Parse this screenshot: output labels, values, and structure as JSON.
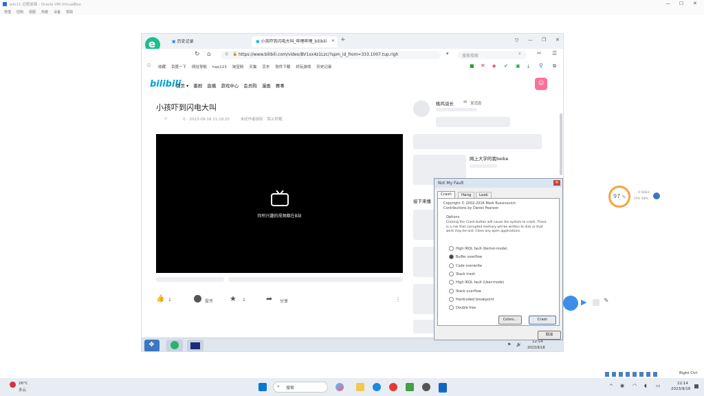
{
  "outer": {
    "title": "win11 远程桌面 - Oracle VM VirtualBox",
    "menu": [
      "管理",
      "控制",
      "视图",
      "热键",
      "设备",
      "帮助"
    ]
  },
  "browser": {
    "tabs": [
      {
        "label": "历史记录"
      },
      {
        "label": "小孩吓到闪电大叫_哔哩哔哩_bilibili"
      }
    ],
    "new_tab_symbol": "+",
    "url": "https://www.bilibili.com/video/BV1xx4z1Lzc/?spm_id_from=333.1007.tup.righ",
    "search_placeholder": "搜索搜索",
    "bookmarks": [
      "收藏",
      "百度一下",
      "网址导航",
      "hao123",
      "淘宝网",
      "天猫",
      "京东",
      "软件下载",
      "好玩游戏",
      "历史记录"
    ]
  },
  "bilibili": {
    "logo": "bilibili",
    "nav": [
      "首页",
      "番剧",
      "直播",
      "游戏中心",
      "会员购",
      "漫画",
      "赛事"
    ],
    "video_title": "小孩吓到闪电大叫",
    "meta": [
      "7",
      "0",
      "2023-09-18 21:18:20",
      "未经作者授权",
      "禁止转载"
    ],
    "player_message": "你所兴趣的视频都在B站",
    "actions": [
      {
        "icon": "thumb-up-icon",
        "label": "1"
      },
      {
        "icon": "coin-icon",
        "label": "投币"
      },
      {
        "icon": "star-icon",
        "label": "1"
      },
      {
        "icon": "share-icon",
        "label": "分享"
      }
    ],
    "more_symbol": "⋮",
    "uploader_name": "桃鸡谈长",
    "uploader_follow": "发消息",
    "related_title": "网上大学的我beike",
    "related_heading": "接下来播"
  },
  "notmyfault": {
    "title": "Not My Fault",
    "tabs": [
      "Crash",
      "Hang",
      "Leak"
    ],
    "copyright": "Copyright © 2002-2016 Mark Russinovich",
    "contributions": "Contributions by Daniel Pearson",
    "options_label": "Options",
    "description": "Clicking the Crash button will cause the system to crash. There is a risk that corrupted memory will be written to disk or that work may be lost. Close any open applications.",
    "options": [
      {
        "label": "High IRQL fault (Kernel-mode)",
        "selected": false
      },
      {
        "label": "Buffer overflow",
        "selected": true
      },
      {
        "label": "Code overwrite",
        "selected": false
      },
      {
        "label": "Stack trash",
        "selected": false
      },
      {
        "label": "High IRQL fault (User-mode)",
        "selected": false
      },
      {
        "label": "Stack overflow",
        "selected": false
      },
      {
        "label": "Hardcoded breakpoint",
        "selected": false
      },
      {
        "label": "Double free",
        "selected": false
      }
    ],
    "buttons": {
      "colors": "Colors...",
      "crash": "Crash",
      "cancel": "取消"
    }
  },
  "guest_taskbar": {
    "time": "12:54",
    "date": "2023/9/18"
  },
  "widget": {
    "percent": "97",
    "unit": "%",
    "speed_up": "0.5KB/s",
    "speed_down": "CPU 58%"
  },
  "host_taskbar": {
    "weather_temp": "26°C",
    "weather_desc": "多云",
    "search_label": "搜索",
    "time": "22:14",
    "date": "2023/9/18",
    "right_ctrl": "Right Ctrl"
  },
  "colors": {
    "bili_blue": "#00a1d6",
    "bili_pink": "#fb7299",
    "win_blue": "#0078d4"
  }
}
